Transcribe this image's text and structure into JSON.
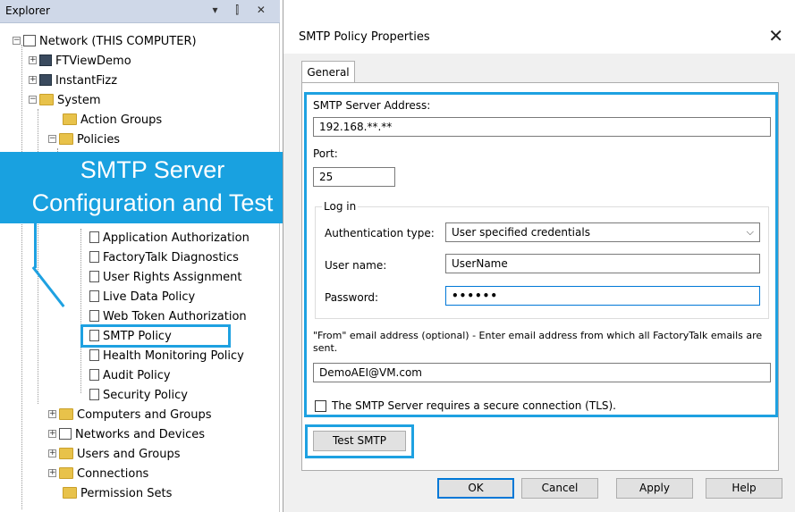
{
  "explorer": {
    "title": "Explorer",
    "controls": "▾ ⫿ ✕",
    "tree": {
      "network": "Network (THIS COMPUTER)",
      "ftviewdemo": "FTViewDemo",
      "instantfizz": "InstantFizz",
      "system": "System",
      "action_groups": "Action Groups",
      "policies": "Policies",
      "application_authorization": "Application Authorization",
      "factorytalk_diagnostics": "FactoryTalk Diagnostics",
      "user_rights_assignment": "User Rights Assignment",
      "live_data_policy": "Live Data Policy",
      "web_token_authorization": "Web Token Authorization",
      "smtp_policy": "SMTP Policy",
      "health_monitoring_policy": "Health Monitoring Policy",
      "audit_policy": "Audit Policy",
      "security_policy": "Security Policy",
      "computers_and_groups": "Computers and Groups",
      "networks_and_devices": "Networks and Devices",
      "users_and_groups": "Users and Groups",
      "connections": "Connections",
      "permission_sets": "Permission Sets"
    }
  },
  "callout": {
    "line1": "SMTP Server",
    "line2": "Configuration and Test"
  },
  "dialog": {
    "title": "SMTP Policy Properties",
    "close": "✕",
    "tab_general": "General",
    "smtp_server_address_label": "SMTP Server Address:",
    "smtp_server_address_value": "192.168.**.**",
    "port_label": "Port:",
    "port_value": "25",
    "login_group": "Log in",
    "auth_type_label": "Authentication type:",
    "auth_type_value": "User specified credentials",
    "username_label": "User name:",
    "username_value": "UserName",
    "password_label": "Password:",
    "password_value": "••••••",
    "from_label": "\"From\" email address (optional) - Enter email address from which all FactoryTalk emails are sent.",
    "from_value": "DemoAEI@VM.com",
    "tls_label": "The SMTP Server requires a secure connection (TLS).",
    "test_smtp": "Test SMTP",
    "ok": "OK",
    "cancel": "Cancel",
    "apply": "Apply",
    "help": "Help"
  },
  "colors": {
    "highlight": "#1ea1e1",
    "callout_bg": "#19a1e0",
    "explorer_title_bg": "#cfd8e8"
  }
}
